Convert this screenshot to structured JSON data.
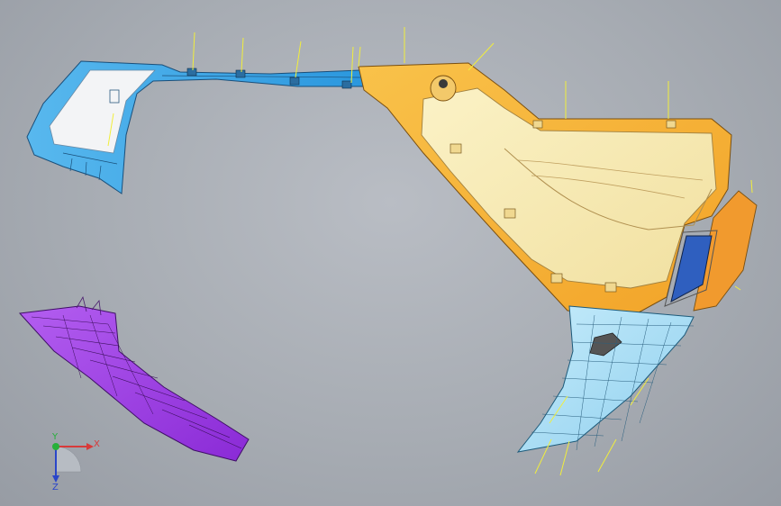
{
  "viewer": {
    "axes": {
      "x_label": "X",
      "y_label": "Y",
      "z_label": "Z"
    },
    "colors": {
      "background": "#a7acb3",
      "upper_trim_blue": "#3aa7e6",
      "upper_trim_white": "#f3f4f6",
      "quarter_panel_orange": "#f7b43a",
      "quarter_panel_cream": "#f7eab6",
      "lower_trim_lightblue": "#a9dcf3",
      "pillar_trim_purple": "#9b3ae0",
      "window_blue": "#2f5fbf",
      "callout_yellow": "#f1ee3c",
      "axis_x": "#d83a3a",
      "axis_y": "#27b03a",
      "axis_z": "#2a46c9"
    }
  }
}
